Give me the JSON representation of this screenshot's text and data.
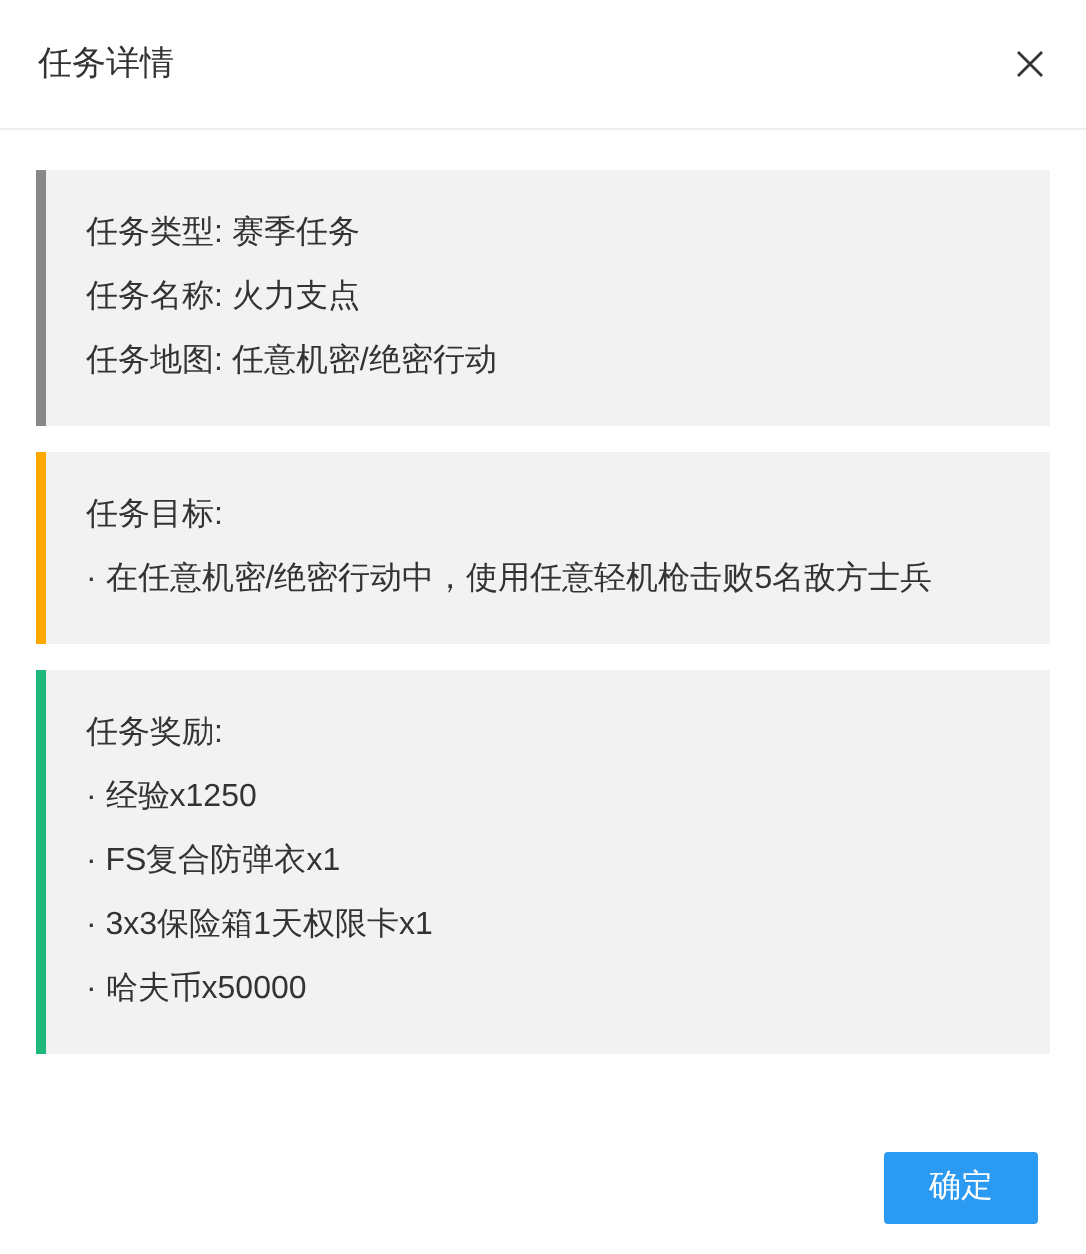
{
  "dialog": {
    "title": "任务详情"
  },
  "sections": [
    {
      "color": "#888888",
      "lines": [
        "任务类型: 赛季任务",
        "任务名称: 火力支点",
        "任务地图: 任意机密/绝密行动"
      ]
    },
    {
      "color": "#ffa800",
      "lines": [
        "任务目标:",
        "· 在任意机密/绝密行动中，使用任意轻机枪击败5名敌方士兵"
      ]
    },
    {
      "color": "#1db87a",
      "lines": [
        "任务奖励:",
        "· 经验x1250",
        "· FS复合防弹衣x1",
        "· 3x3保险箱1天权限卡x1",
        "· 哈夫币x50000"
      ]
    }
  ],
  "buttons": [
    {
      "label": "确定"
    }
  ]
}
